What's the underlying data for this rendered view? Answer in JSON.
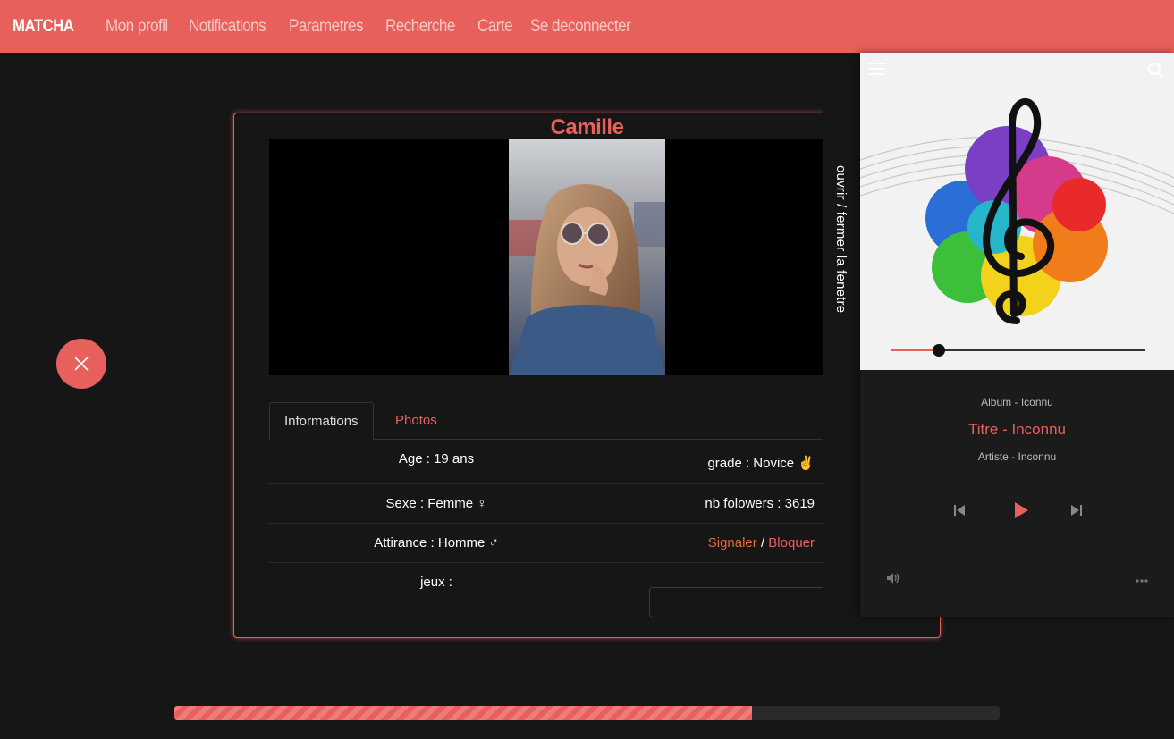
{
  "navbar": {
    "brand": "MATCHA",
    "links": [
      "Mon profil",
      "Notifications",
      "Parametres",
      "Recherche",
      "Carte",
      "Se deconnecter"
    ]
  },
  "colors": {
    "accent": "#e8605c",
    "background": "#161616",
    "link_orange": "#e06a3a"
  },
  "profile": {
    "name": "Camille",
    "tabs": [
      "Informations",
      "Photos"
    ],
    "age": "Age : 19 ans",
    "grade": "grade : Novice ✌",
    "sexe": "Sexe : Femme ♀",
    "followers": "nb folowers : 3619",
    "attirance": "Attirance : Homme ♂",
    "report_label": "Signaler",
    "separator": "/",
    "block_label": "Bloquer",
    "jeux_label": "jeux :",
    "jeux_value": ""
  },
  "side_toggle": {
    "label": "ouvrir / fermer la fenetre"
  },
  "player": {
    "album": "Album - Iconnu",
    "title": "Titre - Inconnu",
    "artist": "Artiste - Inconnu",
    "seek_progress": 0.19,
    "icons": [
      "menu-icon",
      "search-icon",
      "previous-icon",
      "play-icon",
      "next-icon",
      "volume-icon",
      "more-icon"
    ]
  },
  "page_progress": {
    "value": 0.7
  }
}
